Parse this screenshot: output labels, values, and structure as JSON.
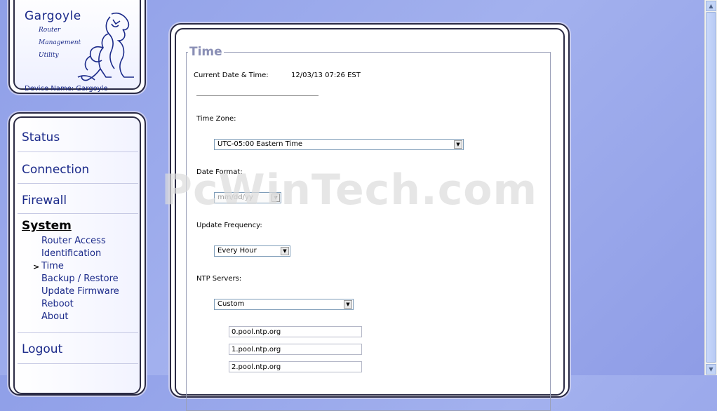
{
  "app": {
    "name": "Gargoyle",
    "tagline": [
      "Router",
      "Management",
      "Utility"
    ],
    "device_name": "Device Name: Gargoyle"
  },
  "nav": {
    "status": "Status",
    "connection": "Connection",
    "firewall": "Firewall",
    "system": "System",
    "logout": "Logout",
    "system_items": [
      "Router Access",
      "Identification",
      "Time",
      "Backup / Restore",
      "Update Firmware",
      "Reboot",
      "About"
    ],
    "current_marker": ">"
  },
  "page": {
    "title": "Time",
    "current_datetime_label": "Current Date & Time:",
    "current_datetime_value": "12/03/13 07:26 EST",
    "timezone_label": "Time Zone:",
    "timezone_value": "UTC-05:00 Eastern Time",
    "date_format_label": "Date Format:",
    "date_format_value": "mm/dd/yy",
    "update_frequency_label": "Update Frequency:",
    "update_frequency_value": "Every Hour",
    "ntp_label": "NTP Servers:",
    "ntp_mode_value": "Custom",
    "ntp_servers": [
      "0.pool.ntp.org",
      "1.pool.ntp.org",
      "2.pool.ntp.org"
    ]
  },
  "watermark": "PcWinTech.com",
  "colors": {
    "background": "#95a4ea",
    "nav_text": "#1b2a8a",
    "legend": "#8a8fb5"
  },
  "icons": {
    "select_arrow": "▼",
    "scroll_up": "▲",
    "scroll_down": "▼"
  }
}
